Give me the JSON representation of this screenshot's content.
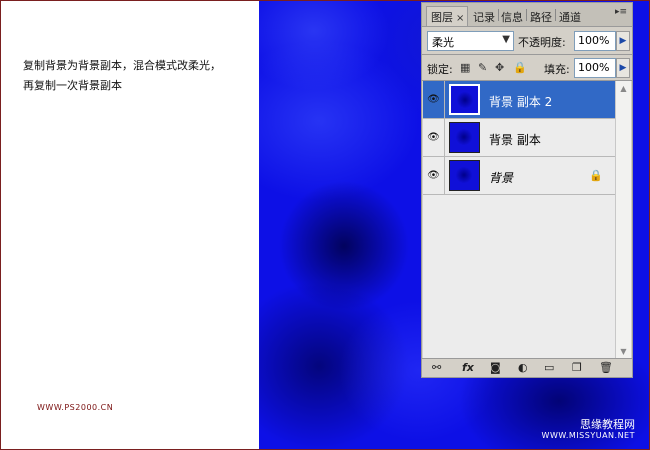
{
  "instructions": {
    "line1": "复制背景为背景副本，混合模式改柔光，",
    "line2": "再复制一次背景副本"
  },
  "site_url": "WWW.PS2000.CN",
  "watermark": {
    "cn": "思缘教程网",
    "en": "WWW.MISSYUAN.NET"
  },
  "panel": {
    "tabs": [
      {
        "label": "图层",
        "active": true
      },
      {
        "label": "记录"
      },
      {
        "label": "信息"
      },
      {
        "label": "路径"
      },
      {
        "label": "通道"
      }
    ],
    "tab_close": "×",
    "menu_icon": "▸≡",
    "blend_mode": "柔光",
    "opacity_label": "不透明度:",
    "opacity_value": "100%",
    "lock_label": "锁定:",
    "fill_label": "填充:",
    "fill_value": "100%",
    "layers": [
      {
        "name": "背景 副本 2",
        "selected": true
      },
      {
        "name": "背景 副本",
        "selected": false
      },
      {
        "name": "背景",
        "selected": false,
        "locked": true
      }
    ],
    "icons": {
      "eye": "eye-icon",
      "lock": "lock-icon",
      "link": "link-icon",
      "fx": "fx-icon",
      "mask": "mask-icon",
      "adjustment": "adjustment-icon",
      "folder": "folder-icon",
      "new_layer": "new-layer-icon",
      "trash": "trash-icon"
    },
    "toolbar": {
      "fx_label": "fx"
    }
  },
  "colors": {
    "canvas_blue": "#0d10e6",
    "selected_row": "#3169c6",
    "site_url": "#7a1010"
  }
}
